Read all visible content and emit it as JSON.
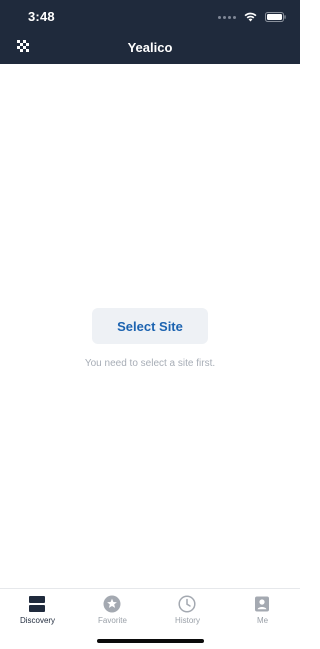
{
  "status_bar": {
    "time": "3:48"
  },
  "header": {
    "title": "Yealico",
    "menu_icon": "grid-icon"
  },
  "main": {
    "select_site_label": "Select Site",
    "hint": "You need to select a site first."
  },
  "tabs": [
    {
      "label": "Discovery",
      "icon": "discovery-icon",
      "active": true
    },
    {
      "label": "Favorite",
      "icon": "star-icon",
      "active": false
    },
    {
      "label": "History",
      "icon": "clock-icon",
      "active": false
    },
    {
      "label": "Me",
      "icon": "user-icon",
      "active": false
    }
  ],
  "colors": {
    "header_bg": "#1f2a3c",
    "accent": "#1c63b0",
    "tab_active": "#1f2a3c",
    "tab_inactive": "#9aa0a8"
  }
}
